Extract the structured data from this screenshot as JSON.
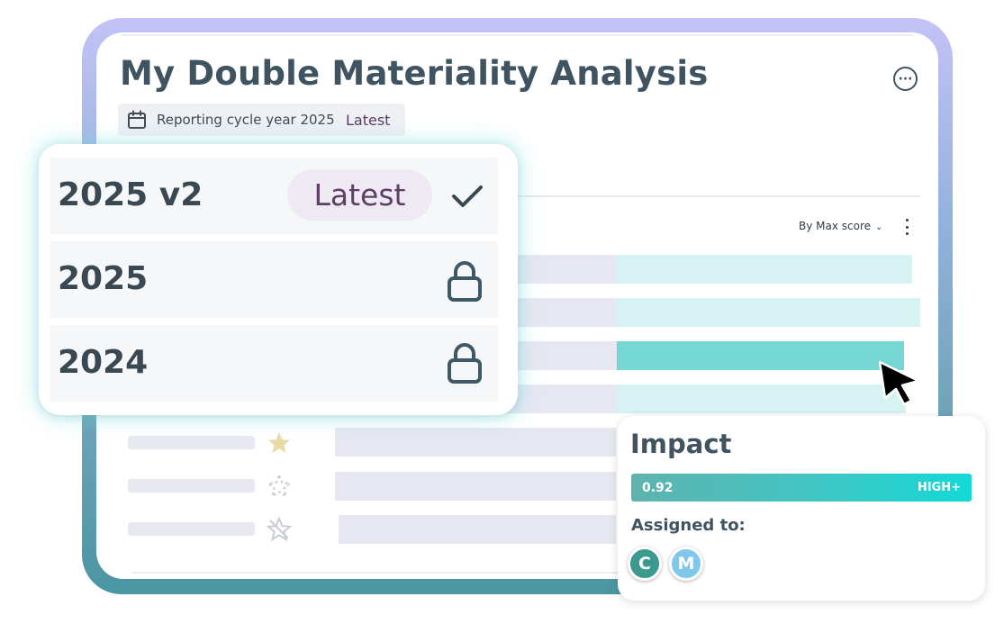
{
  "page": {
    "title": "My Double Materiality Analysis",
    "more_icon": "more-horizontal-icon"
  },
  "cycle": {
    "icon": "calendar-icon",
    "label": "Reporting cycle year 2025",
    "badge": "Latest"
  },
  "sort": {
    "label": "By Max score",
    "icon": "chevron-down-icon",
    "menu_icon": "more-vertical-icon"
  },
  "rows": [
    {
      "icon": null
    },
    {
      "icon": null
    },
    {
      "icon": null,
      "active": true
    },
    {
      "icon": null
    },
    {
      "icon": "star-filled-icon"
    },
    {
      "icon": "star-dashed-icon"
    },
    {
      "icon": "star-crossed-icon"
    }
  ],
  "versions": [
    {
      "label": "2025 v2",
      "badge": "Latest",
      "status_icon": "check-icon"
    },
    {
      "label": "2025",
      "status_icon": "lock-icon"
    },
    {
      "label": "2024",
      "status_icon": "lock-icon"
    }
  ],
  "impact": {
    "title": "Impact",
    "score": "0.92",
    "level": "HIGH+",
    "assigned_label": "Assigned to:",
    "assignees": [
      {
        "initial": "C",
        "color": "#3a9a8e"
      },
      {
        "initial": "M",
        "color": "#80c8ea"
      }
    ]
  },
  "colors": {
    "title_text": "#3f5360",
    "latest_text": "#5b3b63",
    "bar_active": "#76d6d3",
    "bar_light": "#d6f2f2"
  }
}
